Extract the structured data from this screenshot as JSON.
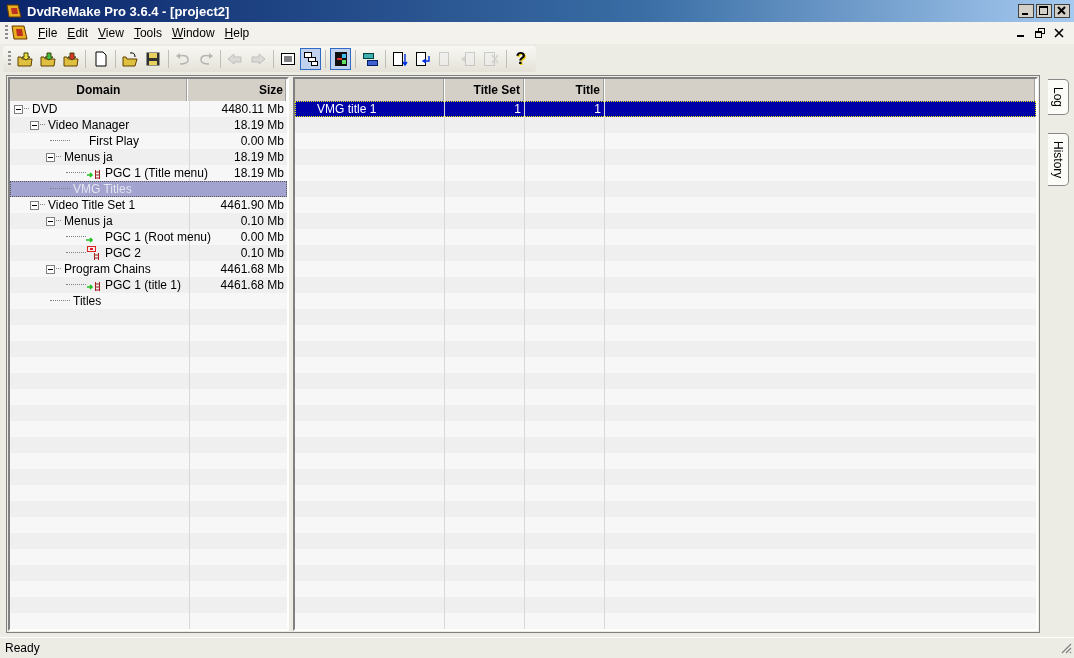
{
  "window": {
    "title": "DvdReMake Pro 3.6.4 - [project2]"
  },
  "menu": [
    "File",
    "Edit",
    "View",
    "Tools",
    "Window",
    "Help"
  ],
  "toolbar": [
    [
      {
        "disabled": false,
        "pressed": false
      },
      {
        "disabled": false,
        "pressed": false
      },
      {
        "disabled": false,
        "pressed": false
      }
    ],
    [
      {
        "disabled": false,
        "pressed": false
      }
    ],
    [
      {
        "disabled": false,
        "pressed": false
      },
      {
        "disabled": false,
        "pressed": false
      }
    ],
    [
      {
        "disabled": true,
        "pressed": false
      },
      {
        "disabled": true,
        "pressed": false
      }
    ],
    [
      {
        "disabled": true,
        "pressed": false
      },
      {
        "disabled": true,
        "pressed": false
      }
    ],
    [
      {
        "disabled": false,
        "pressed": false
      },
      {
        "disabled": false,
        "pressed": true
      }
    ],
    [
      {
        "disabled": false,
        "pressed": true
      }
    ],
    [
      {
        "disabled": false,
        "pressed": false
      }
    ],
    [
      {
        "disabled": false,
        "pressed": false
      },
      {
        "disabled": false,
        "pressed": false
      },
      {
        "disabled": true,
        "pressed": false
      },
      {
        "disabled": true,
        "pressed": false
      },
      {
        "disabled": true,
        "pressed": false
      }
    ]
  ],
  "help_button": {
    "label": "?"
  },
  "tree": {
    "columns": [
      "Domain",
      "Size"
    ],
    "items": [
      {
        "label": "DVD",
        "size": "4480.11 Mb",
        "expanded": true,
        "selected": false,
        "children": [
          {
            "label": "Video Manager",
            "size": "18.19 Mb",
            "expanded": true,
            "selected": false,
            "children": [
              {
                "label": "First Play",
                "size": "0.00 Mb",
                "kind": "plain",
                "selected": false
              },
              {
                "label": "Menus ja",
                "size": "18.19 Mb",
                "expanded": true,
                "selected": false,
                "children": [
                  {
                    "label": "PGC 1 (Title menu)",
                    "size": "18.19 Mb",
                    "kind": "play-chain",
                    "selected": false
                  }
                ]
              },
              {
                "label": "VMG Titles",
                "kind": "folder",
                "selected": true
              }
            ]
          },
          {
            "label": "Video Title Set 1",
            "size": "4461.90 Mb",
            "expanded": true,
            "selected": false,
            "children": [
              {
                "label": "Menus ja",
                "size": "0.10 Mb",
                "expanded": true,
                "selected": false,
                "children": [
                  {
                    "label": "PGC 1 (Root menu)",
                    "size": "0.00 Mb",
                    "kind": "play",
                    "selected": false
                  },
                  {
                    "label": "PGC 2",
                    "size": "0.10 Mb",
                    "kind": "menu-chain",
                    "selected": false
                  }
                ]
              },
              {
                "label": "Program Chains",
                "size": "4461.68 Mb",
                "expanded": true,
                "selected": false,
                "children": [
                  {
                    "label": "PGC 1  (title 1)",
                    "size": "4461.68 Mb",
                    "kind": "play-chain",
                    "selected": false
                  }
                ]
              },
              {
                "label": "Titles",
                "kind": "folder",
                "selected": false
              }
            ]
          }
        ]
      }
    ]
  },
  "table": {
    "columns": [
      "Title Set",
      "Title"
    ],
    "rows": [
      {
        "name": "VMG title 1",
        "title_set": "1",
        "title": "1",
        "selected": true
      }
    ]
  },
  "side_tabs": [
    "Log",
    "History"
  ],
  "status_bar": "Ready"
}
